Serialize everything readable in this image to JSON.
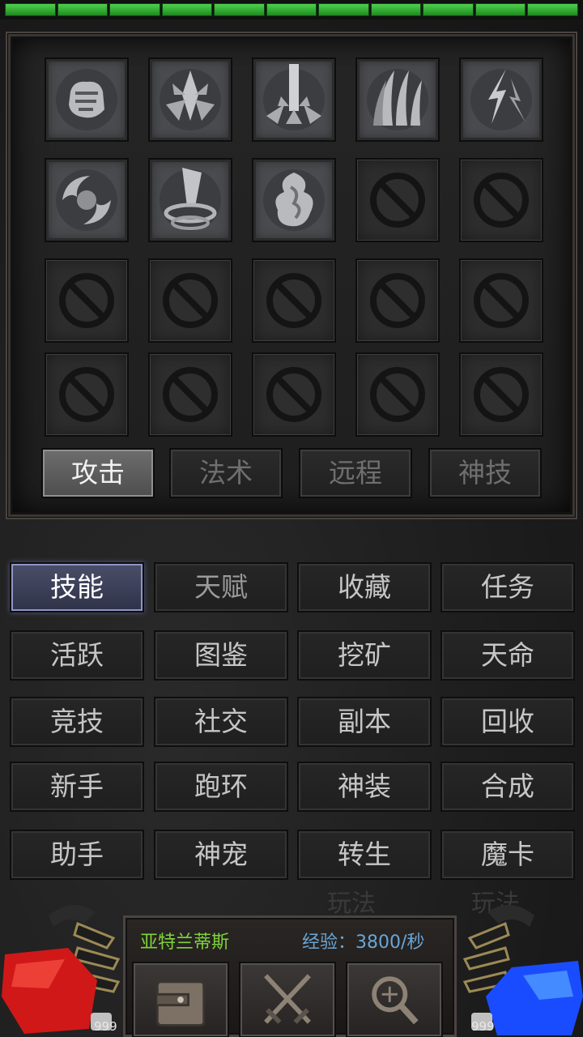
{
  "health_bar": {
    "segments": 11,
    "fill": 1.0
  },
  "skills": {
    "slots": [
      {
        "icon": "fist-icon",
        "filled": true
      },
      {
        "icon": "crystal-burst-icon",
        "filled": true
      },
      {
        "icon": "light-pillar-icon",
        "filled": true
      },
      {
        "icon": "claw-slash-icon",
        "filled": true
      },
      {
        "icon": "lightning-strike-icon",
        "filled": true
      },
      {
        "icon": "whirlwind-icon",
        "filled": true
      },
      {
        "icon": "vortex-icon",
        "filled": true
      },
      {
        "icon": "spirit-flame-icon",
        "filled": true
      },
      {
        "icon": "locked-icon",
        "filled": false
      },
      {
        "icon": "locked-icon",
        "filled": false
      },
      {
        "icon": "locked-icon",
        "filled": false
      },
      {
        "icon": "locked-icon",
        "filled": false
      },
      {
        "icon": "locked-icon",
        "filled": false
      },
      {
        "icon": "locked-icon",
        "filled": false
      },
      {
        "icon": "locked-icon",
        "filled": false
      },
      {
        "icon": "locked-icon",
        "filled": false
      },
      {
        "icon": "locked-icon",
        "filled": false
      },
      {
        "icon": "locked-icon",
        "filled": false
      },
      {
        "icon": "locked-icon",
        "filled": false
      },
      {
        "icon": "locked-icon",
        "filled": false
      }
    ],
    "tabs": [
      {
        "label": "攻击",
        "active": true
      },
      {
        "label": "法术",
        "active": false
      },
      {
        "label": "远程",
        "active": false
      },
      {
        "label": "神技",
        "active": false
      }
    ]
  },
  "menu": {
    "items": [
      {
        "label": "技能",
        "active": true
      },
      {
        "label": "天赋",
        "active": false
      },
      {
        "label": "收藏",
        "active": false
      },
      {
        "label": "任务",
        "active": false
      },
      {
        "label": "活跃",
        "active": false
      },
      {
        "label": "图鉴",
        "active": false
      },
      {
        "label": "挖矿",
        "active": false
      },
      {
        "label": "天命",
        "active": false
      },
      {
        "label": "竞技",
        "active": false
      },
      {
        "label": "社交",
        "active": false
      },
      {
        "label": "副本",
        "active": false
      },
      {
        "label": "回收",
        "active": false
      },
      {
        "label": "新手",
        "active": false
      },
      {
        "label": "跑环",
        "active": false
      },
      {
        "label": "神装",
        "active": false
      },
      {
        "label": "合成",
        "active": false
      },
      {
        "label": "助手",
        "active": false
      },
      {
        "label": "神宠",
        "active": false
      },
      {
        "label": "转生",
        "active": false
      },
      {
        "label": "魔卡",
        "active": false
      }
    ],
    "watermark": "玩法"
  },
  "hud": {
    "player_name": "亚特兰蒂斯",
    "exp_rate": "经验：3800/秒",
    "buttons": [
      {
        "icon": "bag-icon"
      },
      {
        "icon": "crossed-swords-icon"
      },
      {
        "icon": "magnifier-icon"
      }
    ],
    "hp_potions": "999",
    "mp_potions": "999"
  },
  "colors": {
    "hp_orb": "#d01818",
    "mp_orb": "#1a4cff",
    "name": "#7fd33b",
    "exp": "#6aa6d6",
    "health": "#3fc43f"
  }
}
